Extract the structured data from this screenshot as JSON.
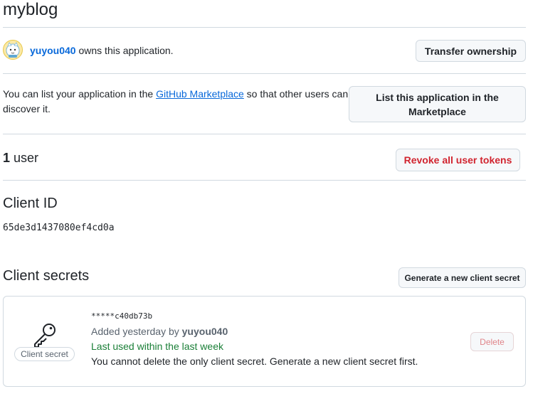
{
  "app": {
    "title": "myblog"
  },
  "owner": {
    "username": "yuyou040",
    "owns_text": " owns this application.",
    "transfer_button": "Transfer ownership"
  },
  "marketplace": {
    "text_before": "You can list your application in the ",
    "link_text": "GitHub Marketplace",
    "text_after_line1": " so that other users can",
    "text_line2": "discover it.",
    "button_line1": "List this application in the",
    "button_line2": "Marketplace"
  },
  "users": {
    "count": "1",
    "label": " user",
    "revoke_button": "Revoke all user tokens"
  },
  "client_id": {
    "heading": "Client ID",
    "value": "65de3d1437080ef4cd0a"
  },
  "client_secrets": {
    "heading": "Client secrets",
    "generate_button": "Generate a new client secret",
    "items": [
      {
        "masked": "*****c40db73b",
        "added_prefix": "Added yesterday by ",
        "added_by": "yuyou040",
        "last_used": "Last used within the last week",
        "note": "You cannot delete the only client secret. Generate a new client secret first.",
        "label": "Client secret",
        "delete_button": "Delete"
      }
    ]
  },
  "colors": {
    "link": "#0969da",
    "danger": "#d1242f",
    "success": "#1a7f37",
    "border": "#d1d9e0",
    "button_bg": "#f6f8fa"
  }
}
